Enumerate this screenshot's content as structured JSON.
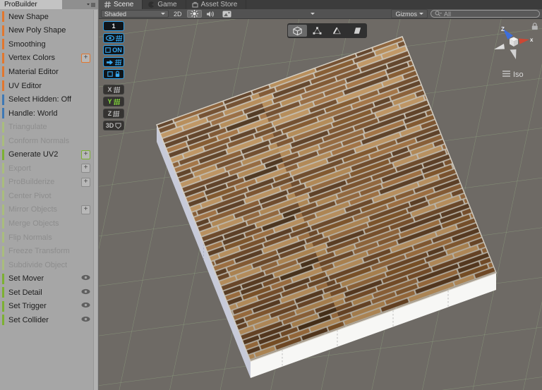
{
  "probuilder": {
    "title": "ProBuilder",
    "plus_label": "+",
    "items": [
      {
        "label": "New Shape",
        "group": "shape",
        "enabled": true,
        "suffix": null
      },
      {
        "label": "New Poly Shape",
        "group": "shape",
        "enabled": true,
        "suffix": null
      },
      {
        "label": "Smoothing",
        "group": "shape",
        "enabled": true,
        "suffix": null
      },
      {
        "label": "Vertex Colors",
        "group": "shape",
        "enabled": true,
        "suffix": "plus"
      },
      {
        "label": "Material Editor",
        "group": "shape",
        "enabled": true,
        "suffix": null
      },
      {
        "label": "UV Editor",
        "group": "shape",
        "enabled": true,
        "suffix": null
      },
      {
        "label": "Select Hidden: Off",
        "group": "selection",
        "enabled": true,
        "suffix": null
      },
      {
        "label": "Handle: World",
        "group": "selection",
        "enabled": true,
        "suffix": null
      },
      {
        "label": "Triangulate",
        "group": "object",
        "enabled": false,
        "suffix": null
      },
      {
        "label": "Conform Normals",
        "group": "object",
        "enabled": false,
        "suffix": null
      },
      {
        "label": "Generate UV2",
        "group": "object",
        "enabled": true,
        "suffix": "plus"
      },
      {
        "label": "Export",
        "group": "object",
        "enabled": false,
        "suffix": "plus"
      },
      {
        "label": "ProBuilderize",
        "group": "object",
        "enabled": false,
        "suffix": "plus"
      },
      {
        "label": "Center Pivot",
        "group": "object",
        "enabled": false,
        "suffix": null
      },
      {
        "label": "Mirror Objects",
        "group": "object",
        "enabled": false,
        "suffix": "plus"
      },
      {
        "label": "Merge Objects",
        "group": "object",
        "enabled": false,
        "suffix": null
      },
      {
        "label": "Flip Normals",
        "group": "object",
        "enabled": false,
        "suffix": null
      },
      {
        "label": "Freeze Transform",
        "group": "object",
        "enabled": false,
        "suffix": null
      },
      {
        "label": "Subdivide Object",
        "group": "object",
        "enabled": false,
        "suffix": null
      },
      {
        "label": "Set Mover",
        "group": "entity",
        "enabled": true,
        "suffix": "eye"
      },
      {
        "label": "Set Detail",
        "group": "entity",
        "enabled": true,
        "suffix": "eye"
      },
      {
        "label": "Set Trigger",
        "group": "entity",
        "enabled": true,
        "suffix": "eye"
      },
      {
        "label": "Set Collider",
        "group": "entity",
        "enabled": true,
        "suffix": "eye"
      }
    ]
  },
  "tabs": [
    {
      "label": "Scene",
      "active": true
    },
    {
      "label": "Game",
      "active": false
    },
    {
      "label": "Asset Store",
      "active": false
    }
  ],
  "scene_toolbar": {
    "draw_mode": "Shaded",
    "mode_2d": "2D",
    "gizmos": "Gizmos",
    "search_value": "All"
  },
  "progrids": {
    "snap_value": "1",
    "snap_on": "ON",
    "axis_x": "X",
    "axis_y": "Y",
    "axis_z": "Z",
    "full_grid": "3D"
  },
  "view_gizmo": {
    "axis_up_label": "Z",
    "axis_right_label": "x",
    "projection": "Iso"
  },
  "colors": {
    "group_shape": "#E2772E",
    "group_selection": "#3E78B4",
    "group_object_enabled": "#7CB032",
    "group_object_disabled": "#A9BD7D",
    "progrids_accent": "#35A8F2",
    "axis_y_active": "#86E03C",
    "grid_line": "#9FBE8F",
    "axis_x_red": "#CC4733",
    "axis_z_blue": "#3E6EDC",
    "scene_background": "#6E6A65",
    "slab_side_left": "#C7CAD9",
    "slab_side_front": "#F7F7F5",
    "plank_mortar": "#C8C1B3",
    "plank_palette": [
      "#a5723f",
      "#8a5c30",
      "#6f4826",
      "#b78a52",
      "#5c3c20",
      "#97683a",
      "#7d5129",
      "#4a3118",
      "#c2955e",
      "#835527"
    ]
  }
}
